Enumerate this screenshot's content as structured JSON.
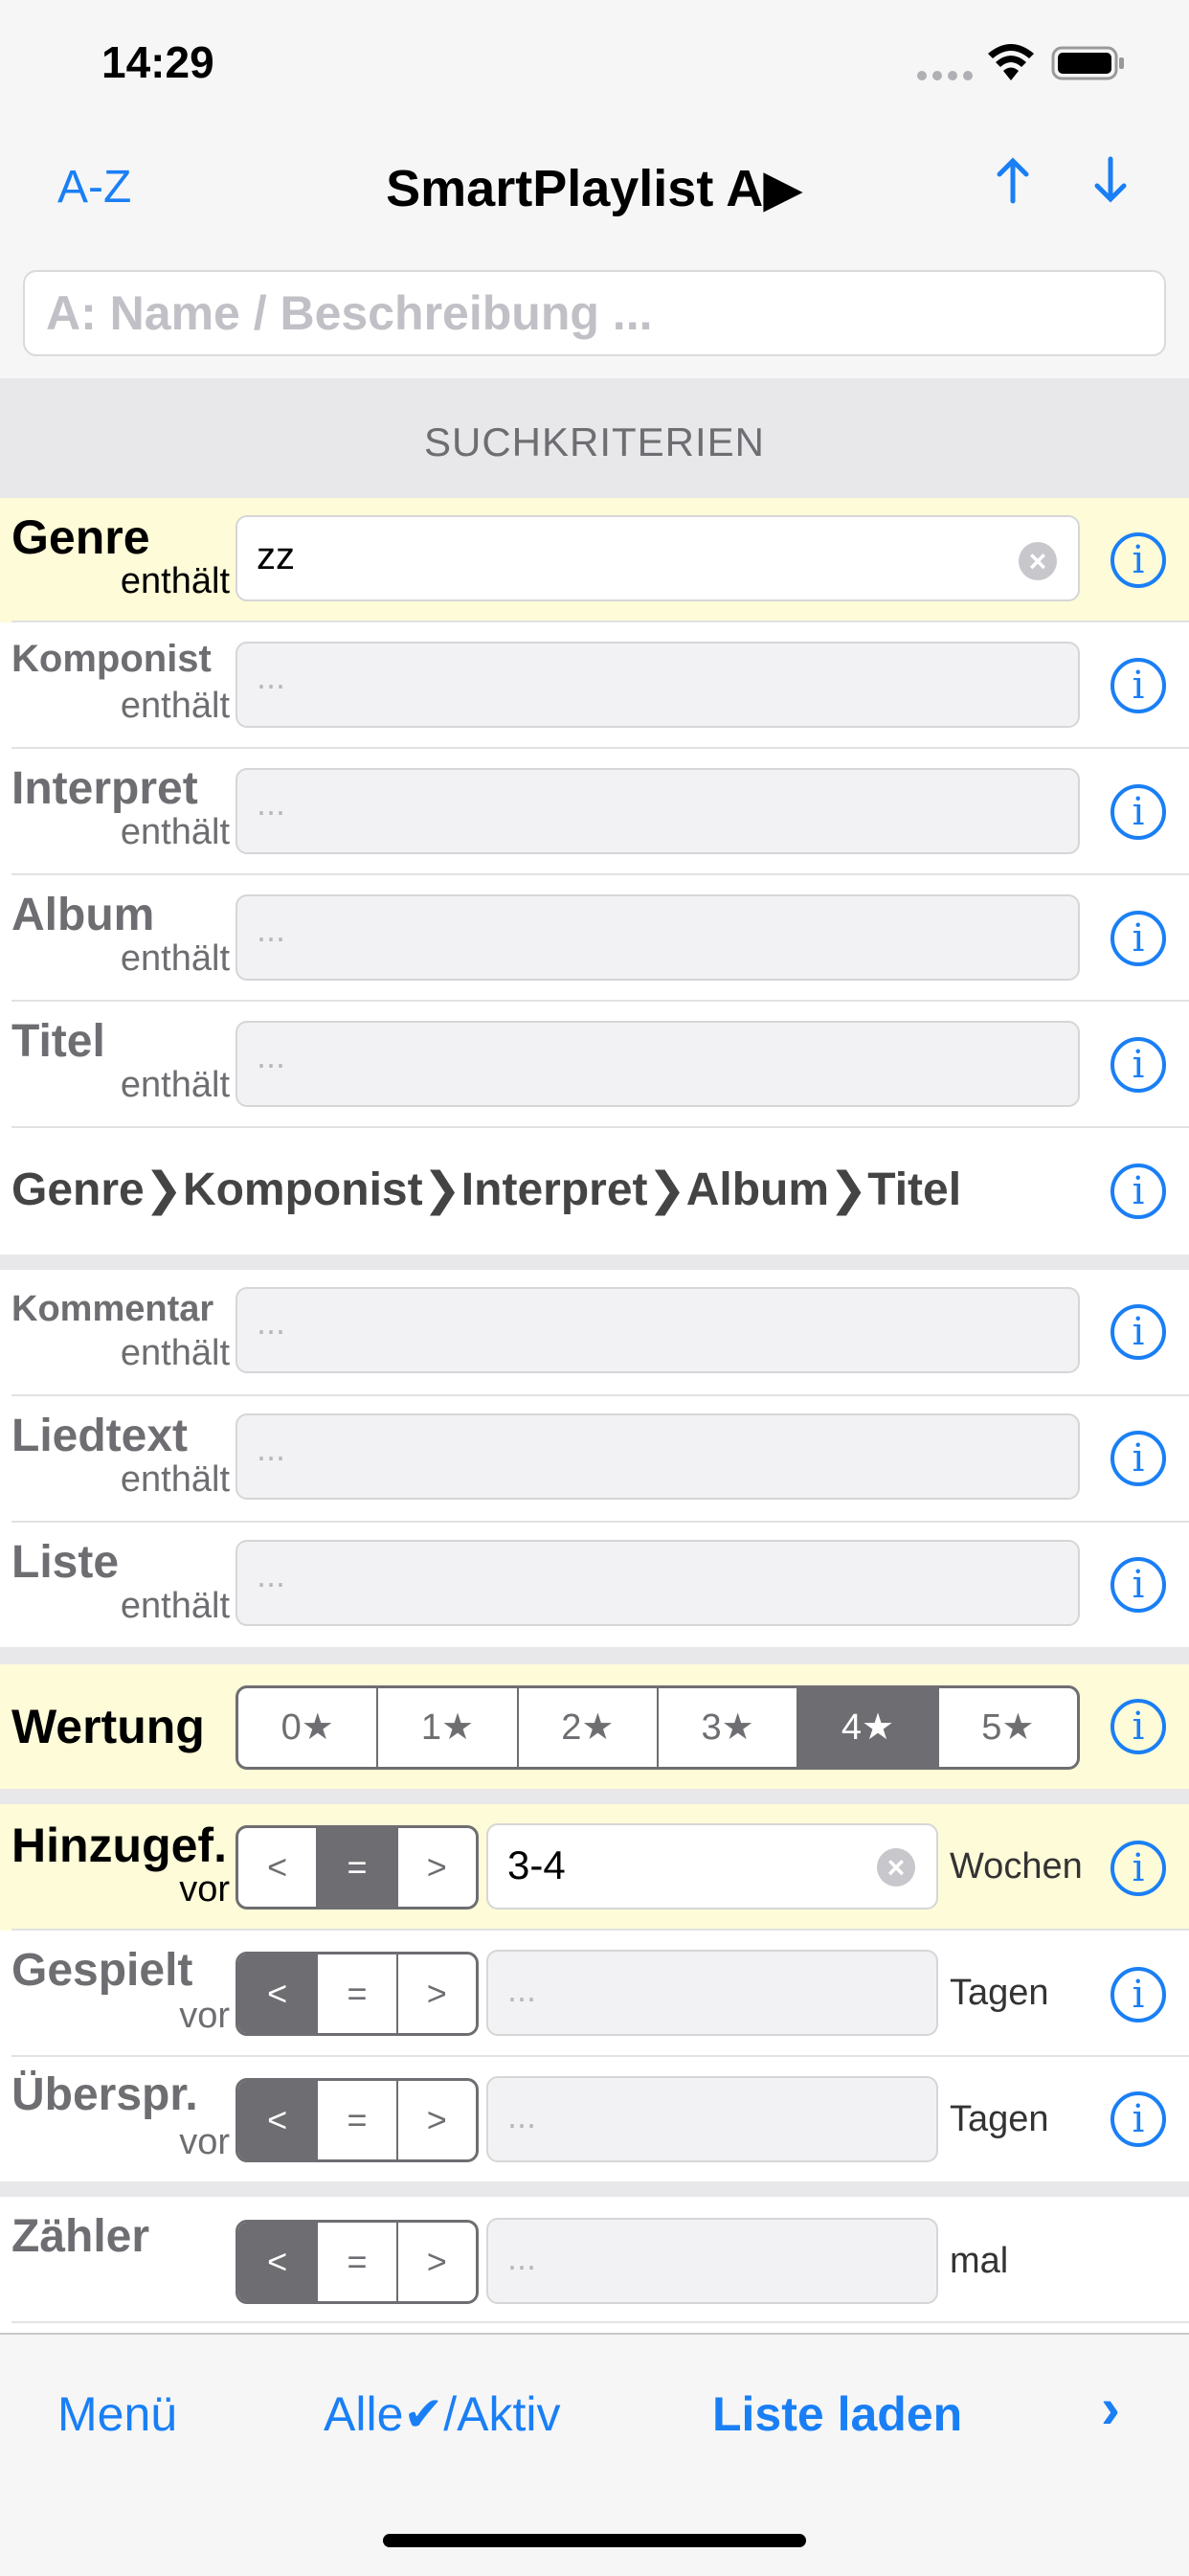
{
  "status": {
    "time": "14:29"
  },
  "nav": {
    "left": "A-Z",
    "title": "SmartPlaylist A▶",
    "up_icon": "arrow-up-icon",
    "down_icon": "arrow-down-icon"
  },
  "search": {
    "placeholder": "A: Name / Beschreibung ..."
  },
  "section": {
    "title": "SUCHKRITERIEN"
  },
  "rows": {
    "genre": {
      "label": "Genre",
      "sub": "enthält",
      "value": "zz"
    },
    "komponist": {
      "label": "Komponist",
      "sub": "enthält",
      "placeholder": "..."
    },
    "interpret": {
      "label": "Interpret",
      "sub": "enthält",
      "placeholder": "..."
    },
    "album": {
      "label": "Album",
      "sub": "enthält",
      "placeholder": "..."
    },
    "titel": {
      "label": "Titel",
      "sub": "enthält",
      "placeholder": "..."
    },
    "kommentar": {
      "label": "Kommentar",
      "sub": "enthält",
      "placeholder": "..."
    },
    "liedtext": {
      "label": "Liedtext",
      "sub": "enthält",
      "placeholder": "..."
    },
    "liste": {
      "label": "Liste",
      "sub": "enthält",
      "placeholder": "..."
    }
  },
  "hierarchy": "Genre❯Komponist❯Interpret❯Album❯Titel",
  "wertung": {
    "label": "Wertung",
    "options": [
      "0★",
      "1★",
      "2★",
      "3★",
      "4★",
      "5★"
    ],
    "selected": "4★"
  },
  "hinzugef": {
    "label": "Hinzugef.",
    "sub": "vor",
    "ops": [
      "<",
      "=",
      ">"
    ],
    "selected": "=",
    "value": "3-4",
    "unit": "Wochen"
  },
  "gespielt": {
    "label": "Gespielt",
    "sub": "vor",
    "ops": [
      "<",
      "=",
      ">"
    ],
    "selected": "<",
    "placeholder": "...",
    "unit": "Tagen"
  },
  "uebersprungen": {
    "label": "Überspr.",
    "sub": "vor",
    "ops": [
      "<",
      "=",
      ">"
    ],
    "selected": "<",
    "placeholder": "...",
    "unit": "Tagen"
  },
  "zaehler": {
    "label": "Zähler",
    "ops": [
      "<",
      "=",
      ">"
    ],
    "selected": "<",
    "placeholder": "...",
    "unit": "mal"
  },
  "toolbar": {
    "menu": "Menü",
    "all": "Alle✔/Aktiv",
    "load": "Liste laden",
    "next": "›"
  },
  "colors": {
    "accent": "#1a7ff5",
    "highlight": "#fefbd8",
    "selected_segment": "#6e6e72"
  }
}
